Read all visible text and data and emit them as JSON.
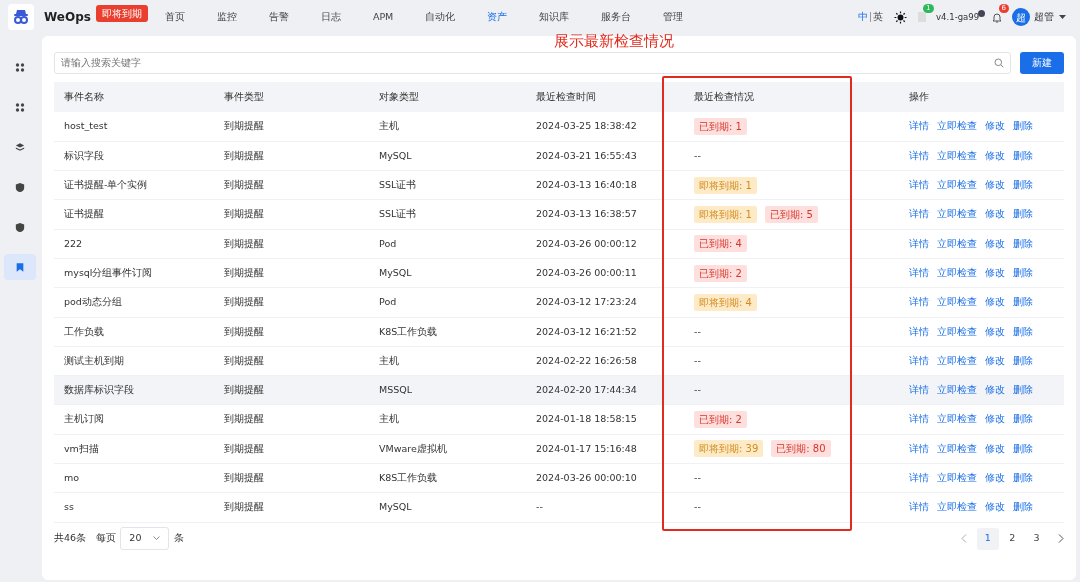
{
  "brand": {
    "name": "WeOps",
    "badge": "即将到期"
  },
  "nav": [
    {
      "label": "首页",
      "selected": false
    },
    {
      "label": "监控",
      "selected": false
    },
    {
      "label": "告警",
      "selected": false
    },
    {
      "label": "日志",
      "selected": false
    },
    {
      "label": "APM",
      "selected": false
    },
    {
      "label": "自动化",
      "selected": false
    },
    {
      "label": "资产",
      "selected": true
    },
    {
      "label": "知识库",
      "selected": false
    },
    {
      "label": "服务台",
      "selected": false
    },
    {
      "label": "管理",
      "selected": false
    }
  ],
  "languages": [
    {
      "label": "中",
      "selected": true
    },
    {
      "label": "英",
      "selected": false
    }
  ],
  "header": {
    "doc_count": "1",
    "version": "v4.1-ga99",
    "alert_count": "6",
    "avatar": "超",
    "user": "超管"
  },
  "sidebar": [
    {
      "selected": false
    },
    {
      "selected": false
    },
    {
      "selected": false
    },
    {
      "selected": false
    },
    {
      "selected": false
    },
    {
      "selected": true
    }
  ],
  "search": {
    "placeholder": "请输入搜索关键字"
  },
  "new_button": "新建",
  "annotation": "展示最新检查情况",
  "table": {
    "columns": [
      "事件名称",
      "事件类型",
      "对象类型",
      "最近检查时间",
      "最近检查情况",
      "操作"
    ],
    "rows": [
      {
        "name": "host_test",
        "type": "到期提醒",
        "object": "主机",
        "time": "2024-03-25 18:38:42",
        "status": [
          {
            "kind": "expired",
            "text": "已到期: 1"
          }
        ],
        "actions": [
          "详情",
          "立即检查",
          "修改",
          "删除"
        ],
        "selected": false
      },
      {
        "name": "标识字段",
        "type": "到期提醒",
        "object": "MySQL",
        "time": "2024-03-21 16:55:43",
        "status_text": "--",
        "actions": [
          "详情",
          "立即检查",
          "修改",
          "删除"
        ],
        "selected": false
      },
      {
        "name": "证书提醒-单个实例",
        "type": "到期提醒",
        "object": "SSL证书",
        "time": "2024-03-13 16:40:18",
        "status": [
          {
            "kind": "expiring",
            "text": "即将到期: 1"
          }
        ],
        "actions": [
          "详情",
          "立即检查",
          "修改",
          "删除"
        ],
        "selected": false
      },
      {
        "name": "证书提醒",
        "type": "到期提醒",
        "object": "SSL证书",
        "time": "2024-03-13 16:38:57",
        "status": [
          {
            "kind": "expiring",
            "text": "即将到期: 1"
          },
          {
            "kind": "expired",
            "text": "已到期: 5"
          }
        ],
        "actions": [
          "详情",
          "立即检查",
          "修改",
          "删除"
        ],
        "selected": false
      },
      {
        "name": "222",
        "type": "到期提醒",
        "object": "Pod",
        "time": "2024-03-26 00:00:12",
        "status": [
          {
            "kind": "expired",
            "text": "已到期: 4"
          }
        ],
        "actions": [
          "详情",
          "立即检查",
          "修改",
          "删除"
        ],
        "selected": false
      },
      {
        "name": "mysql分组事件订阅",
        "type": "到期提醒",
        "object": "MySQL",
        "time": "2024-03-26 00:00:11",
        "status": [
          {
            "kind": "expired",
            "text": "已到期: 2"
          }
        ],
        "actions": [
          "详情",
          "立即检查",
          "修改",
          "删除"
        ],
        "selected": false
      },
      {
        "name": "pod动态分组",
        "type": "到期提醒",
        "object": "Pod",
        "time": "2024-03-12 17:23:24",
        "status": [
          {
            "kind": "expiring",
            "text": "即将到期: 4"
          }
        ],
        "actions": [
          "详情",
          "立即检查",
          "修改",
          "删除"
        ],
        "selected": false
      },
      {
        "name": "工作负载",
        "type": "到期提醒",
        "object": "K8S工作负载",
        "time": "2024-03-12 16:21:52",
        "status_text": "--",
        "actions": [
          "详情",
          "立即检查",
          "修改",
          "删除"
        ],
        "selected": false
      },
      {
        "name": "测试主机到期",
        "type": "到期提醒",
        "object": "主机",
        "time": "2024-02-22 16:26:58",
        "status_text": "--",
        "actions": [
          "详情",
          "立即检查",
          "修改",
          "删除"
        ],
        "selected": false
      },
      {
        "name": "数据库标识字段",
        "type": "到期提醒",
        "object": "MSSQL",
        "time": "2024-02-20 17:44:34",
        "status_text": "--",
        "actions": [
          "详情",
          "立即检查",
          "修改",
          "删除"
        ],
        "selected": true
      },
      {
        "name": "主机订阅",
        "type": "到期提醒",
        "object": "主机",
        "time": "2024-01-18 18:58:15",
        "status": [
          {
            "kind": "expired",
            "text": "已到期: 2"
          }
        ],
        "actions": [
          "详情",
          "立即检查",
          "修改",
          "删除"
        ],
        "selected": false
      },
      {
        "name": "vm扫描",
        "type": "到期提醒",
        "object": "VMware虚拟机",
        "time": "2024-01-17 15:16:48",
        "status": [
          {
            "kind": "expiring",
            "text": "即将到期: 39"
          },
          {
            "kind": "expired",
            "text": "已到期: 80"
          }
        ],
        "actions": [
          "详情",
          "立即检查",
          "修改",
          "删除"
        ],
        "selected": false
      },
      {
        "name": "mo",
        "type": "到期提醒",
        "object": "K8S工作负载",
        "time": "2024-03-26 00:00:10",
        "status_text": "--",
        "actions": [
          "详情",
          "立即检查",
          "修改",
          "删除"
        ],
        "selected": false
      },
      {
        "name": "ss",
        "type": "到期提醒",
        "object": "MySQL",
        "time": "--",
        "status_text": "--",
        "actions": [
          "详情",
          "立即检查",
          "修改",
          "删除"
        ],
        "selected": false
      }
    ]
  },
  "pagination": {
    "total": "共46条",
    "per_page_label": "每页",
    "per_page": "20",
    "unit": "条",
    "pages": [
      {
        "label": "1",
        "selected": true
      },
      {
        "label": "2",
        "selected": false
      },
      {
        "label": "3",
        "selected": false
      }
    ]
  }
}
